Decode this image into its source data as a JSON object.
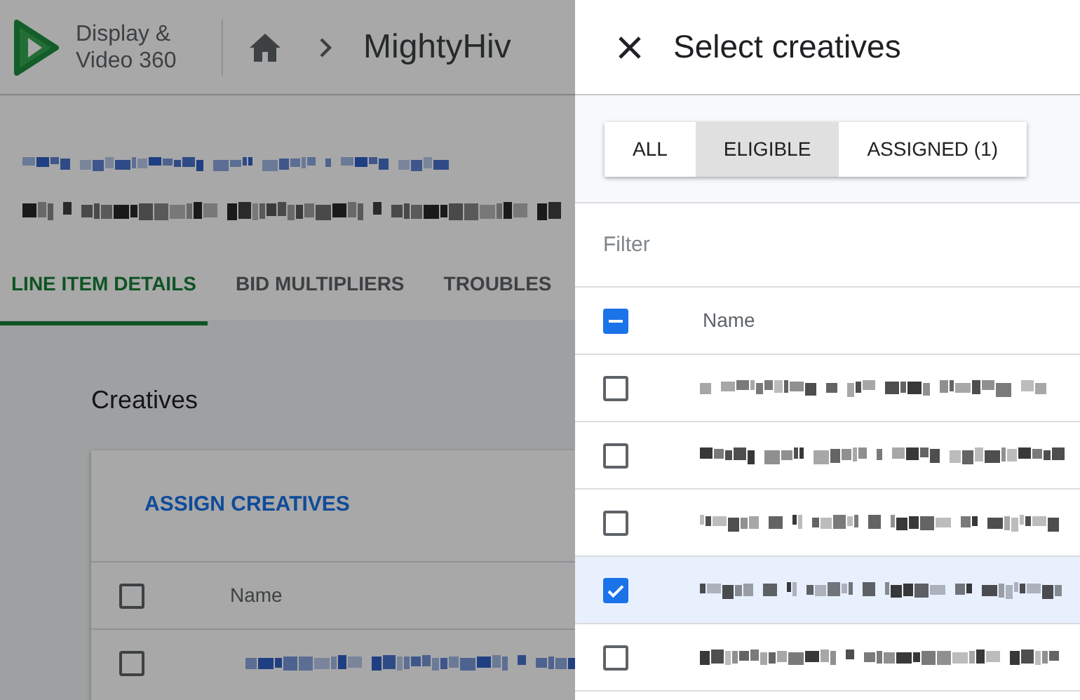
{
  "app": {
    "product_name": "Display & Video 360",
    "breadcrumb": "MightyHiv"
  },
  "tabs": [
    {
      "label": "LINE ITEM DETAILS",
      "selected": true
    },
    {
      "label": "BID MULTIPLIERS",
      "selected": false
    },
    {
      "label": "TROUBLES",
      "selected": false
    }
  ],
  "creatives_section": {
    "title": "Creatives",
    "action": "ASSIGN CREATIVES",
    "column": "Name",
    "header_checkbox": {
      "checked": false
    },
    "rows": [
      {
        "checked": false
      }
    ]
  },
  "dialog": {
    "title": "Select creatives",
    "segments": [
      {
        "label": "ALL",
        "selected": false
      },
      {
        "label": "ELIGIBLE",
        "selected": true
      },
      {
        "label": "ASSIGNED (1)",
        "selected": false
      }
    ],
    "filter": {
      "placeholder": "Filter"
    },
    "column": "Name",
    "header_checkbox": {
      "indeterminate": true
    },
    "rows": [
      {
        "checked": false,
        "selected": false
      },
      {
        "checked": false,
        "selected": false
      },
      {
        "checked": false,
        "selected": false
      },
      {
        "checked": true,
        "selected": true
      },
      {
        "checked": false,
        "selected": false
      }
    ]
  }
}
